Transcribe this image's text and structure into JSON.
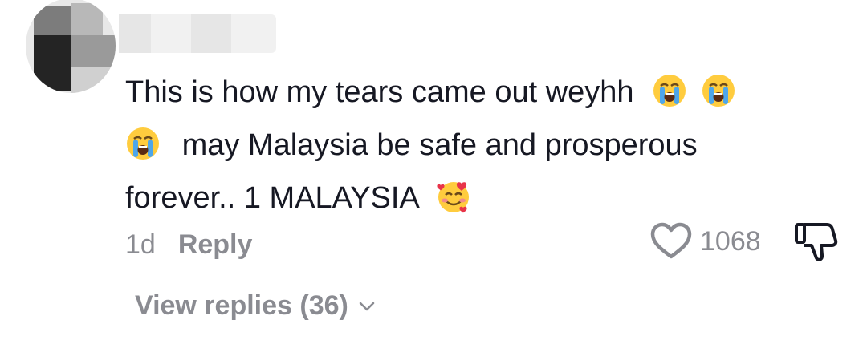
{
  "comment": {
    "line1": "This is how my tears came out weyhh",
    "line2": "may Malaysia be safe and prosperous",
    "line3": "forever.. 1 MALAYSIA",
    "icons": {
      "crying": "loudly-crying-face-emoji",
      "hearts": "smiling-face-with-hearts-emoji"
    }
  },
  "meta": {
    "time": "1d",
    "reply_label": "Reply"
  },
  "likes": {
    "count": "1068"
  },
  "replies": {
    "label": "View replies (36)"
  },
  "colors": {
    "text": "#161823",
    "muted": "#8a8b91",
    "background": "#ffffff"
  }
}
